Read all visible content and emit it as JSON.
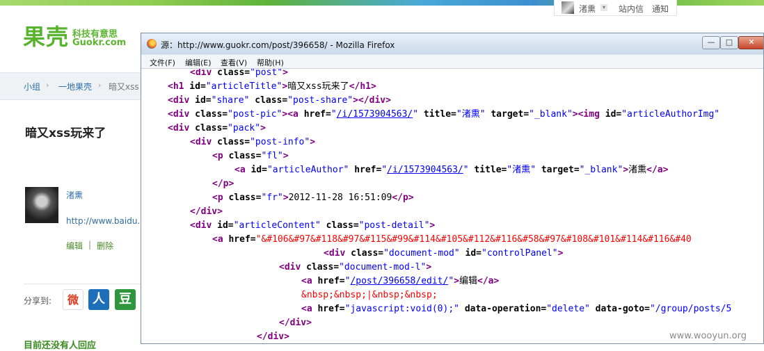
{
  "site": {
    "logo_main": "果壳",
    "logo_tagline": "科技有意思",
    "logo_domain": "Guokr.com",
    "user_name": "渚熏",
    "user_menu_caret": "▾",
    "messages_label": "站内信",
    "notices_label": "通知",
    "breadcrumb": [
      "小组",
      "一地果壳",
      "暗又xss"
    ],
    "breadcrumb_sep": "›",
    "post_title": "暗又xss玩来了",
    "author_name": "渚熏",
    "author_link": "http://www.baidu.co",
    "edit_label": "编辑",
    "action_sep": "|",
    "delete_label": "删除",
    "share_label": "分享到:",
    "share_icons": [
      "weibo-icon",
      "renren-icon",
      "douban-icon"
    ],
    "share_glyphs": [
      "微",
      "人",
      "豆"
    ],
    "no_reply_text": "目前还没有人回应"
  },
  "window": {
    "title": "源：http://www.guokr.com/post/396658/ - Mozilla Firefox",
    "buttons": {
      "minimize": "—",
      "maximize": "□",
      "close": "✕"
    },
    "menu": [
      "文件(F)",
      "编辑(E)",
      "查看(V)",
      "帮助(H)"
    ]
  },
  "source": {
    "l1": {
      "t1": "<div",
      "a1": " class=",
      "v1": "\"post\"",
      "t2": ">"
    },
    "l2": {
      "t1": "<h1",
      "a1": " id=",
      "v1": "\"articleTitle\"",
      "t2": ">",
      "x1": "暗又xss玩来了",
      "t3": "</h1>"
    },
    "l3": {
      "t1": "<div",
      "a1": " id=",
      "v1": "\"share\"",
      "a2": " class=",
      "v2": "\"post-share\"",
      "t2": "></div>"
    },
    "l4": {
      "t1": "<div",
      "a1": " class=",
      "v1": "\"post-pic\"",
      "t2": "><a",
      "a2": " href=",
      "q1": "\"",
      "u1": "/i/1573904563/",
      "q2": "\"",
      "a3": " title=",
      "v2": "\"渚熏\"",
      "a4": " target=",
      "v3": "\"_blank\"",
      "t3": "><img",
      "a5": " id=",
      "v4": "\"articleAuthorImg\""
    },
    "l5": {
      "t1": "<div",
      "a1": " class=",
      "v1": "\"pack\"",
      "t2": ">"
    },
    "l6": {
      "t1": "<div",
      "a1": " class=",
      "v1": "\"post-info\"",
      "t2": ">"
    },
    "l7": {
      "t1": "<p",
      "a1": " class=",
      "v1": "\"fl\"",
      "t2": ">"
    },
    "l8": {
      "t1": "<a",
      "a1": " id=",
      "v1": "\"articleAuthor\"",
      "a2": " href=",
      "q1": "\"",
      "u1": "/i/1573904563/",
      "q2": "\"",
      "a3": " title=",
      "v2": "\"渚熏\"",
      "a4": " target=",
      "v3": "\"_blank\"",
      "t2": ">",
      "x1": "渚熏",
      "t3": "</a>"
    },
    "l9": {
      "t1": "</p>"
    },
    "l10": {
      "t1": "<p",
      "a1": " class=",
      "v1": "\"fr\"",
      "t2": ">",
      "x1": "2012-11-28 16:51:09",
      "t3": "</p>"
    },
    "l11": {
      "t1": "</div>"
    },
    "l12": {
      "t1": "<div",
      "a1": " id=",
      "v1": "\"articleContent\"",
      "a2": " class=",
      "v2": "\"post-detail\"",
      "t2": ">"
    },
    "l13": {
      "t1": "<a",
      "a1": " href=",
      "e1": "\"&#106&#97&#118&#97&#115&#99&#114&#105&#112&#116&#58&#97&#108&#101&#114&#116&#40"
    },
    "l14": {
      "t1": "<div",
      "a1": " class=",
      "v1": "\"document-mod\"",
      "a2": " id=",
      "v2": "\"controlPanel\"",
      "t2": ">"
    },
    "l15": {
      "t1": "<div",
      "a1": " class=",
      "v1": "\"document-mod-l\"",
      "t2": ">"
    },
    "l16": {
      "t1": "<a",
      "a1": " href=",
      "q1": "\"",
      "u1": "/post/396658/edit/",
      "q2": "\"",
      "t2": ">",
      "x1": "编辑",
      "t3": "</a>"
    },
    "l17": {
      "e1": "&nbsp;&nbsp;|&nbsp;&nbsp;"
    },
    "l18": {
      "t1": "<a",
      "a1": " href=",
      "v1": "\"javascript:void(0);\"",
      "a2": " data-operation=",
      "v2": "\"delete\"",
      "a3": " data-goto=",
      "v3": "\"/group/posts/5"
    },
    "l19": {
      "t1": "</div>"
    },
    "l20": {
      "t1": "</div>"
    }
  },
  "watermark": "www.wooyun.org"
}
